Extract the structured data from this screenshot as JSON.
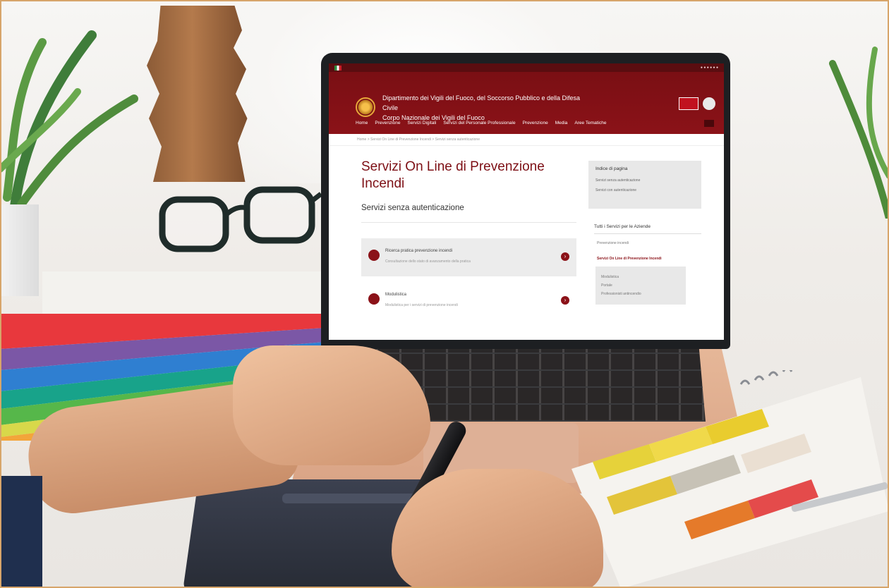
{
  "photo": {
    "description_colors": {
      "brand_red": "#8b1218",
      "frame_border": "#d7a56a"
    }
  },
  "website": {
    "header": {
      "org_line_1": "Dipartimento dei Vigili del Fuoco, del Soccorso Pubblico e della Difesa Civile",
      "org_line_2": "Corpo Nazionale dei Vigili del Fuoco",
      "nav": [
        "Home",
        "Prevenzione",
        "Servizi Digitali",
        "Servizi del Personale Professionale",
        "Prevenzione",
        "Media",
        "Aree Tematiche"
      ]
    },
    "breadcrumb": "Home > Servizi On Line di Prevenzione Incendi > Servizi senza autenticazione",
    "main": {
      "title": "Servizi On Line di Prevenzione Incendi",
      "subtitle": "Servizi senza autenticazione",
      "services": [
        {
          "title": "Ricerca pratica prevenzione incendi",
          "desc": "Consultazione dello stato di avanzamento della pratica"
        },
        {
          "title": "Modulistica",
          "desc": "Modulistica per i servizi di prevenzione incendi"
        }
      ]
    },
    "sidebar": {
      "box_title": "Indice di pagina",
      "box_links": [
        "Servizi senza autenticazione",
        "Servizi con autenticazione"
      ],
      "list_title": "Tutti i Servizi per le Aziende",
      "items": [
        "Prevenzione incendi",
        "Servizi On Line di Prevenzione Incendi"
      ],
      "sub_items": [
        "Modulistica",
        "Portale",
        "Professionisti antincendio"
      ]
    }
  }
}
